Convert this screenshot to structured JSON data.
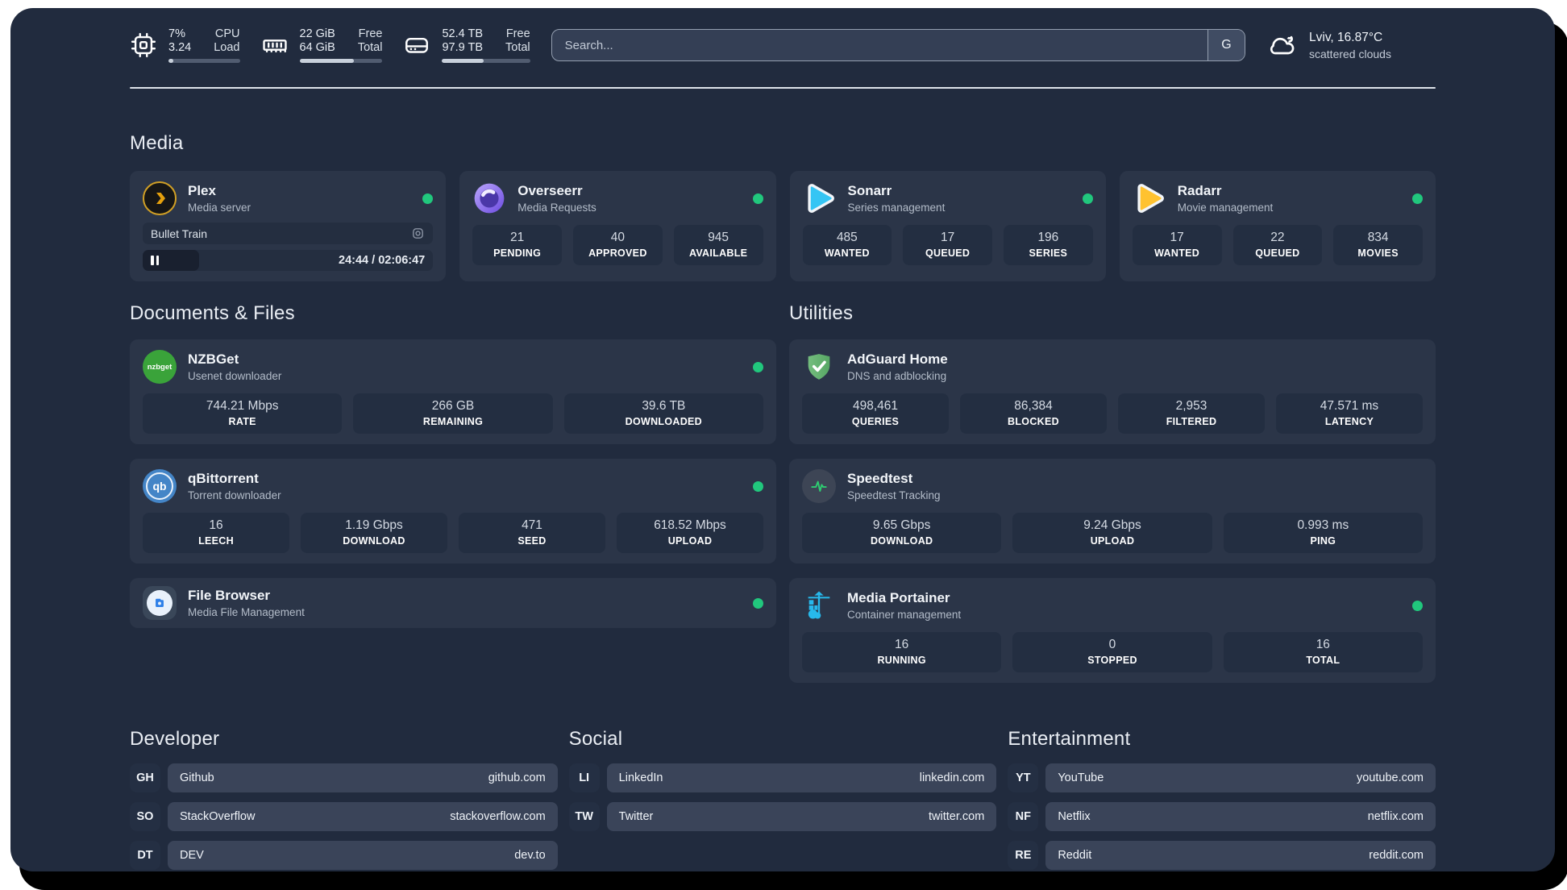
{
  "header": {
    "cpu": {
      "top_value": "7%",
      "bottom_value": "3.24",
      "top_label": "CPU",
      "bottom_label": "Load",
      "progress_pct": 7
    },
    "memory": {
      "top_value": "22 GiB",
      "bottom_value": "64 GiB",
      "top_label": "Free",
      "bottom_label": "Total",
      "progress_pct": 66
    },
    "disk": {
      "top_value": "52.4 TB",
      "bottom_value": "97.9 TB",
      "top_label": "Free",
      "bottom_label": "Total",
      "progress_pct": 47
    },
    "search": {
      "placeholder": "Search...",
      "button_label": "G"
    },
    "weather": {
      "location": "Lviv, 16.87°C",
      "condition": "scattered clouds"
    }
  },
  "sections": {
    "media": "Media",
    "documents": "Documents & Files",
    "utilities": "Utilities"
  },
  "apps": {
    "plex": {
      "name": "Plex",
      "desc": "Media server",
      "now_playing": {
        "title": "Bullet Train",
        "time": "24:44 / 02:06:47",
        "progress_pct": 19.5
      }
    },
    "overseerr": {
      "name": "Overseerr",
      "desc": "Media Requests",
      "stats": [
        {
          "value": "21",
          "label": "PENDING"
        },
        {
          "value": "40",
          "label": "APPROVED"
        },
        {
          "value": "945",
          "label": "AVAILABLE"
        }
      ]
    },
    "sonarr": {
      "name": "Sonarr",
      "desc": "Series management",
      "stats": [
        {
          "value": "485",
          "label": "WANTED"
        },
        {
          "value": "17",
          "label": "QUEUED"
        },
        {
          "value": "196",
          "label": "SERIES"
        }
      ]
    },
    "radarr": {
      "name": "Radarr",
      "desc": "Movie management",
      "stats": [
        {
          "value": "17",
          "label": "WANTED"
        },
        {
          "value": "22",
          "label": "QUEUED"
        },
        {
          "value": "834",
          "label": "MOVIES"
        }
      ]
    },
    "nzbget": {
      "name": "NZBGet",
      "desc": "Usenet downloader",
      "icon_text": "nzbget",
      "stats": [
        {
          "value": "744.21 Mbps",
          "label": "RATE"
        },
        {
          "value": "266 GB",
          "label": "REMAINING"
        },
        {
          "value": "39.6 TB",
          "label": "DOWNLOADED"
        }
      ]
    },
    "qbittorrent": {
      "name": "qBittorrent",
      "desc": "Torrent downloader",
      "icon_text": "qb",
      "stats": [
        {
          "value": "16",
          "label": "LEECH"
        },
        {
          "value": "1.19 Gbps",
          "label": "DOWNLOAD"
        },
        {
          "value": "471",
          "label": "SEED"
        },
        {
          "value": "618.52 Mbps",
          "label": "UPLOAD"
        }
      ]
    },
    "filebrowser": {
      "name": "File Browser",
      "desc": "Media File Management"
    },
    "adguard": {
      "name": "AdGuard Home",
      "desc": "DNS and adblocking",
      "stats": [
        {
          "value": "498,461",
          "label": "QUERIES"
        },
        {
          "value": "86,384",
          "label": "BLOCKED"
        },
        {
          "value": "2,953",
          "label": "FILTERED"
        },
        {
          "value": "47.571 ms",
          "label": "LATENCY"
        }
      ]
    },
    "speedtest": {
      "name": "Speedtest",
      "desc": "Speedtest Tracking",
      "stats": [
        {
          "value": "9.65 Gbps",
          "label": "DOWNLOAD"
        },
        {
          "value": "9.24 Gbps",
          "label": "UPLOAD"
        },
        {
          "value": "0.993 ms",
          "label": "PING"
        }
      ]
    },
    "portainer": {
      "name": "Media Portainer",
      "desc": "Container management",
      "stats": [
        {
          "value": "16",
          "label": "RUNNING"
        },
        {
          "value": "0",
          "label": "STOPPED"
        },
        {
          "value": "16",
          "label": "TOTAL"
        }
      ]
    }
  },
  "links": {
    "developer": {
      "title": "Developer",
      "items": [
        {
          "abbr": "GH",
          "name": "Github",
          "url": "github.com"
        },
        {
          "abbr": "SO",
          "name": "StackOverflow",
          "url": "stackoverflow.com"
        },
        {
          "abbr": "DT",
          "name": "DEV",
          "url": "dev.to"
        }
      ]
    },
    "social": {
      "title": "Social",
      "items": [
        {
          "abbr": "LI",
          "name": "LinkedIn",
          "url": "linkedin.com"
        },
        {
          "abbr": "TW",
          "name": "Twitter",
          "url": "twitter.com"
        }
      ]
    },
    "entertainment": {
      "title": "Entertainment",
      "items": [
        {
          "abbr": "YT",
          "name": "YouTube",
          "url": "youtube.com"
        },
        {
          "abbr": "NF",
          "name": "Netflix",
          "url": "netflix.com"
        },
        {
          "abbr": "RE",
          "name": "Reddit",
          "url": "reddit.com"
        }
      ]
    }
  },
  "colors": {
    "background": "#212b3e",
    "card": "#2b3548",
    "tile": "#232e41",
    "status_online": "#21c77d",
    "plex_gold": "#e5a00d",
    "sonarr_blue": "#35c5f4",
    "radarr_amber": "#ffc230",
    "adguard_green": "#67b279",
    "portainer_cyan": "#27b9ec"
  }
}
